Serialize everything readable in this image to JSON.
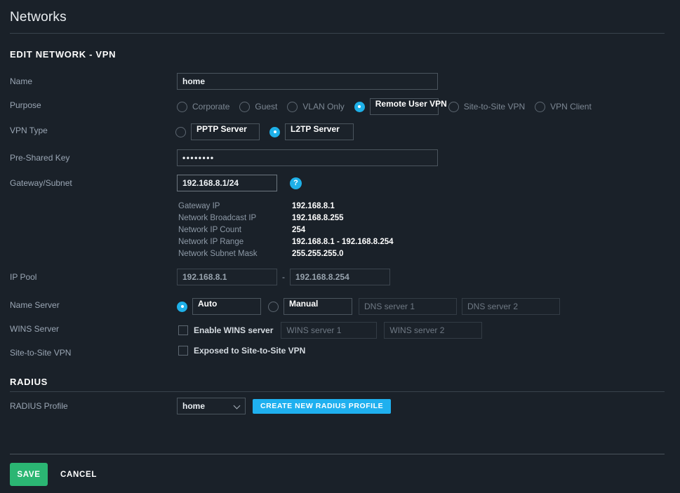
{
  "header": {
    "title": "Networks"
  },
  "sections": {
    "edit_network": "EDIT NETWORK - VPN",
    "radius": "RADIUS"
  },
  "fields": {
    "name": {
      "label": "Name",
      "value": "home"
    },
    "purpose": {
      "label": "Purpose",
      "options": [
        {
          "label": "Corporate",
          "selected": false
        },
        {
          "label": "Guest",
          "selected": false
        },
        {
          "label": "VLAN Only",
          "selected": false
        },
        {
          "label": "Remote User VPN",
          "selected": true
        },
        {
          "label": "Site-to-Site VPN",
          "selected": false
        },
        {
          "label": "VPN Client",
          "selected": false
        }
      ]
    },
    "vpn_type": {
      "label": "VPN Type",
      "options": [
        {
          "label": "PPTP Server",
          "selected": false
        },
        {
          "label": "L2TP Server",
          "selected": true
        }
      ]
    },
    "pre_shared_key": {
      "label": "Pre-Shared Key",
      "value": "••••••••"
    },
    "gateway_subnet": {
      "label": "Gateway/Subnet",
      "value": "192.168.8.1/24",
      "help_icon": "help-icon",
      "help_glyph": "?"
    },
    "ip_pool": {
      "label": "IP Pool",
      "start": "192.168.8.1",
      "separator": "-",
      "end": "192.168.8.254"
    },
    "name_server": {
      "label": "Name Server",
      "options": [
        {
          "label": "Auto",
          "selected": true
        },
        {
          "label": "Manual",
          "selected": false
        }
      ],
      "dns1_placeholder": "DNS server 1",
      "dns2_placeholder": "DNS server 2",
      "dns1_value": "",
      "dns2_value": ""
    },
    "wins_server": {
      "label": "WINS Server",
      "checkbox_label": "Enable WINS server",
      "checked": false,
      "wins1_placeholder": "WINS server 1",
      "wins2_placeholder": "WINS server 2",
      "wins1_value": "",
      "wins2_value": ""
    },
    "site_to_site": {
      "label": "Site-to-Site VPN",
      "checkbox_label": "Exposed to Site-to-Site VPN",
      "checked": false
    },
    "radius_profile": {
      "label": "RADIUS Profile",
      "value": "home",
      "options": [
        "home"
      ],
      "create_button": "CREATE NEW RADIUS PROFILE"
    }
  },
  "network_info": {
    "rows": [
      {
        "key": "Gateway IP",
        "value": "192.168.8.1"
      },
      {
        "key": "Network Broadcast IP",
        "value": "192.168.8.255"
      },
      {
        "key": "Network IP Count",
        "value": "254"
      },
      {
        "key": "Network IP Range",
        "value": "192.168.8.1 - 192.168.8.254"
      },
      {
        "key": "Network Subnet Mask",
        "value": "255.255.255.0"
      }
    ]
  },
  "footer": {
    "save": "SAVE",
    "cancel": "CANCEL"
  },
  "colors": {
    "background": "#1a2129",
    "accent_blue": "#1fb0ef",
    "save_green": "#2bb673",
    "label_gray": "#9aa6b4"
  }
}
